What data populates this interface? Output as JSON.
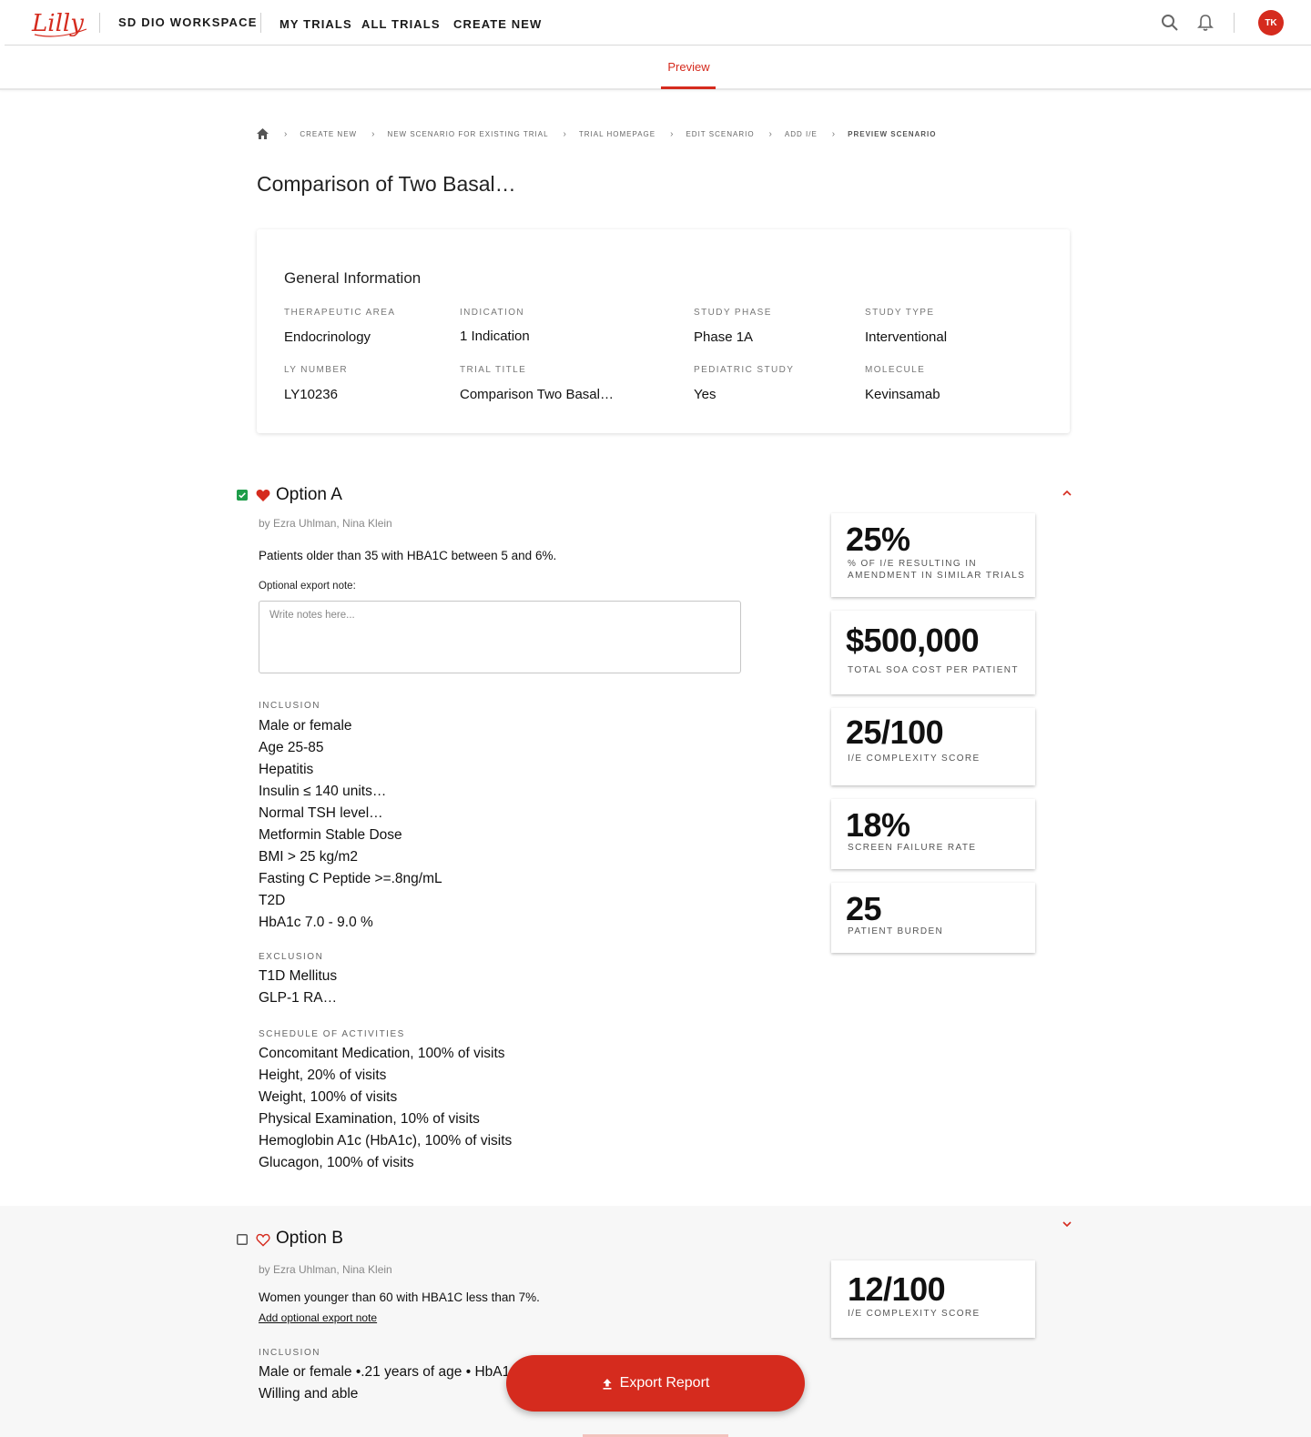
{
  "header": {
    "brand_logo": "Lilly",
    "workspace": "SD DIO WORKSPACE",
    "nav": [
      "MY TRIALS",
      "ALL TRIALS",
      "CREATE NEW"
    ],
    "avatar_initials": "TK",
    "icons": [
      "search-icon",
      "bell-icon"
    ]
  },
  "subnav": {
    "active_tab": "Preview"
  },
  "breadcrumb": [
    "CREATE NEW",
    "NEW SCENARIO FOR EXISTING TRIAL",
    "TRIAL HOMEPAGE",
    "EDIT SCENARIO",
    "ADD I/E",
    "PREVIEW SCENARIO"
  ],
  "page_title": "Comparison of Two Basal…",
  "general_info": {
    "heading": "General Information",
    "fields": [
      {
        "label": "THERAPEUTIC AREA",
        "value": "Endocrinology"
      },
      {
        "label": "INDICATION",
        "value": "1 Indication"
      },
      {
        "label": "STUDY PHASE",
        "value": "Phase 1A"
      },
      {
        "label": "STUDY TYPE",
        "value": "Interventional"
      },
      {
        "label": "LY NUMBER",
        "value": "LY10236"
      },
      {
        "label": "TRIAL TITLE",
        "value": "Comparison Two Basal…"
      },
      {
        "label": "PEDIATRIC STUDY",
        "value": "Yes"
      },
      {
        "label": "MOLECULE",
        "value": "Kevinsamab"
      }
    ]
  },
  "option_a": {
    "title": "Option A",
    "selected": true,
    "favorited": true,
    "byline": "by Ezra Uhlman, Nina Klein",
    "description": "Patients older than 35 with HBA1C between 5 and 6%.",
    "note_label": "Optional export note:",
    "note_placeholder": "Write notes here...",
    "inclusion_label": "INCLUSION",
    "inclusion": [
      "Male or female",
      "Age 25-85",
      "Hepatitis",
      "Insulin ≤ 140 units…",
      "Normal TSH level…",
      "Metformin Stable Dose",
      "BMI > 25 kg/m2",
      "Fasting C Peptide >=.8ng/mL",
      "T2D",
      "HbA1c 7.0 - 9.0 %"
    ],
    "exclusion_label": "EXCLUSION",
    "exclusion": [
      "T1D Mellitus",
      "GLP-1 RA…"
    ],
    "soa_label": "SCHEDULE OF ACTIVITIES",
    "soa": [
      "Concomitant Medication, 100% of visits",
      "Height, 20% of visits",
      "Weight, 100% of visits",
      "Physical Examination, 10% of visits",
      "Hemoglobin A1c (HbA1c), 100% of visits",
      "Glucagon, 100% of visits"
    ],
    "metrics": [
      {
        "value": "25%",
        "label": "% OF I/E RESULTING IN AMENDMENT IN SIMILAR TRIALS"
      },
      {
        "value": "$500,000",
        "label": "TOTAL SOA COST PER PATIENT"
      },
      {
        "value": "25/100",
        "label": "I/E COMPLEXITY SCORE"
      },
      {
        "value": "18%",
        "label": "SCREEN FAILURE RATE"
      },
      {
        "value": "25",
        "label": "PATIENT BURDEN"
      }
    ]
  },
  "option_b": {
    "title": "Option B",
    "selected": false,
    "favorited": false,
    "byline": "by Ezra Uhlman, Nina Klein",
    "description": "Women younger than 60 with HBA1C less than 7%.",
    "add_note_link": "Add optional export note",
    "inclusion_label": "INCLUSION",
    "inclusion": [
      "Male or female •.21 years of age • HbA1",
      "Willing and able"
    ],
    "metrics": [
      {
        "value": "12/100",
        "label": "I/E COMPLEXITY SCORE"
      }
    ]
  },
  "export_button": "Export Report",
  "colors": {
    "brand_red": "#d52b1e",
    "check_green": "#1f9d4a"
  }
}
